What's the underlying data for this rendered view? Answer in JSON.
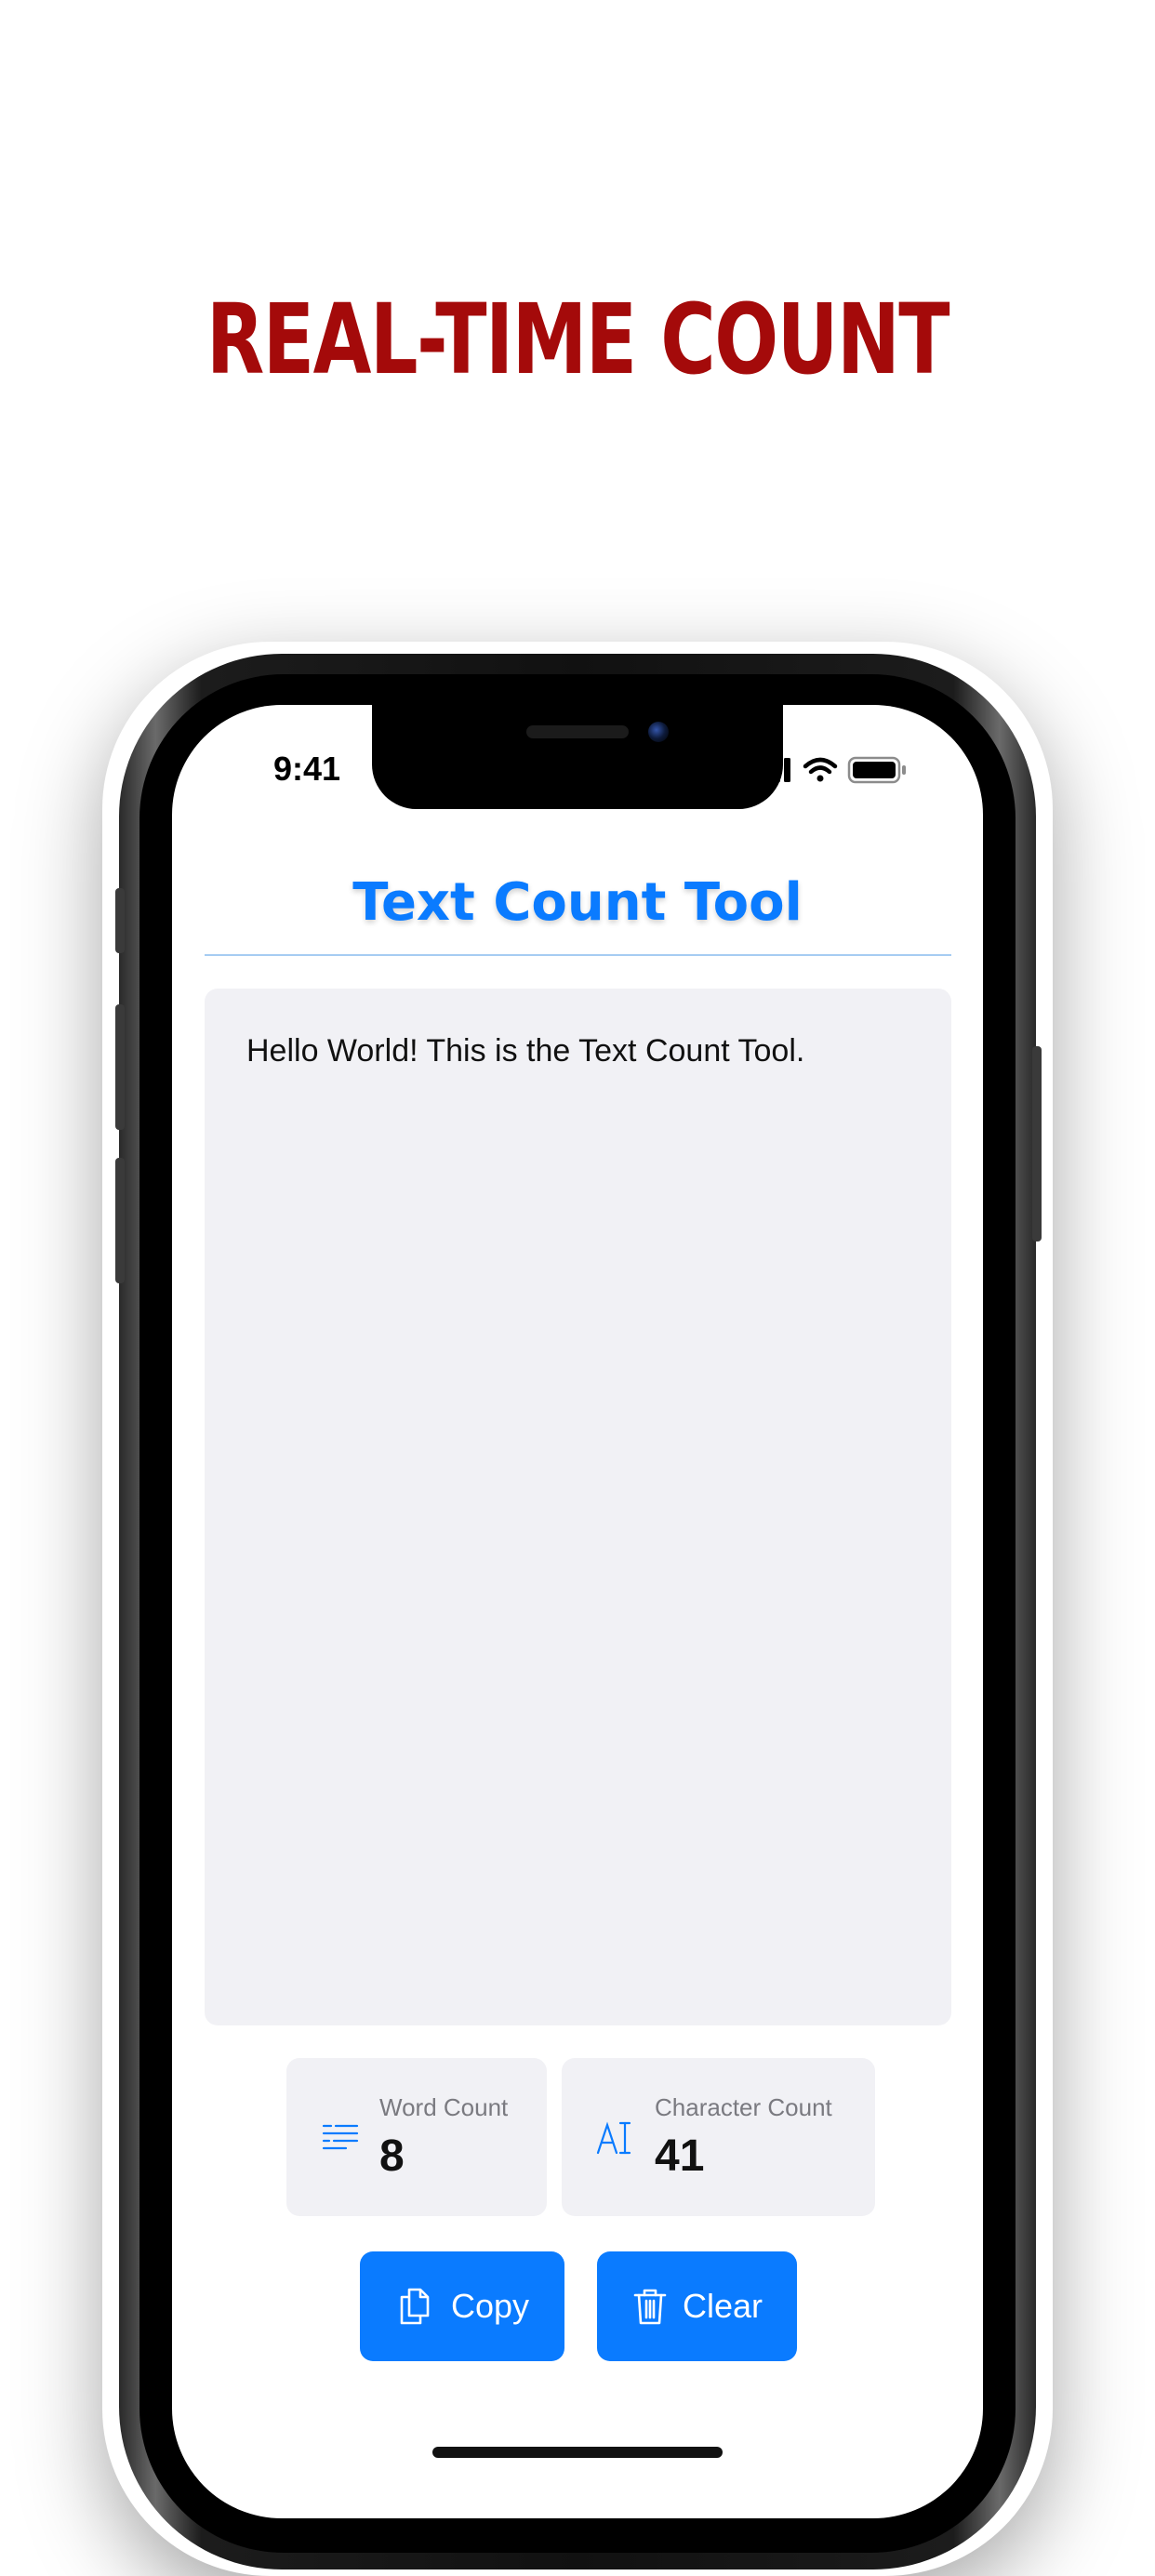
{
  "promo": {
    "headline": "REAL-TIME COUNT"
  },
  "status_bar": {
    "time": "9:41"
  },
  "app": {
    "title": "Text Count Tool",
    "text_input": {
      "value": "Hello World! This is the Text Count Tool."
    },
    "stats": [
      {
        "label": "Word Count",
        "value": "8",
        "icon": "list-lines-icon"
      },
      {
        "label": "Character Count",
        "value": "41",
        "icon": "text-cursor-icon"
      }
    ],
    "buttons": {
      "copy": {
        "label": "Copy",
        "icon": "copy-icon"
      },
      "clear": {
        "label": "Clear",
        "icon": "trash-icon"
      }
    }
  },
  "colors": {
    "accent": "#0a7bff",
    "headline": "#a40a0a",
    "card_background": "#f1f1f5"
  }
}
